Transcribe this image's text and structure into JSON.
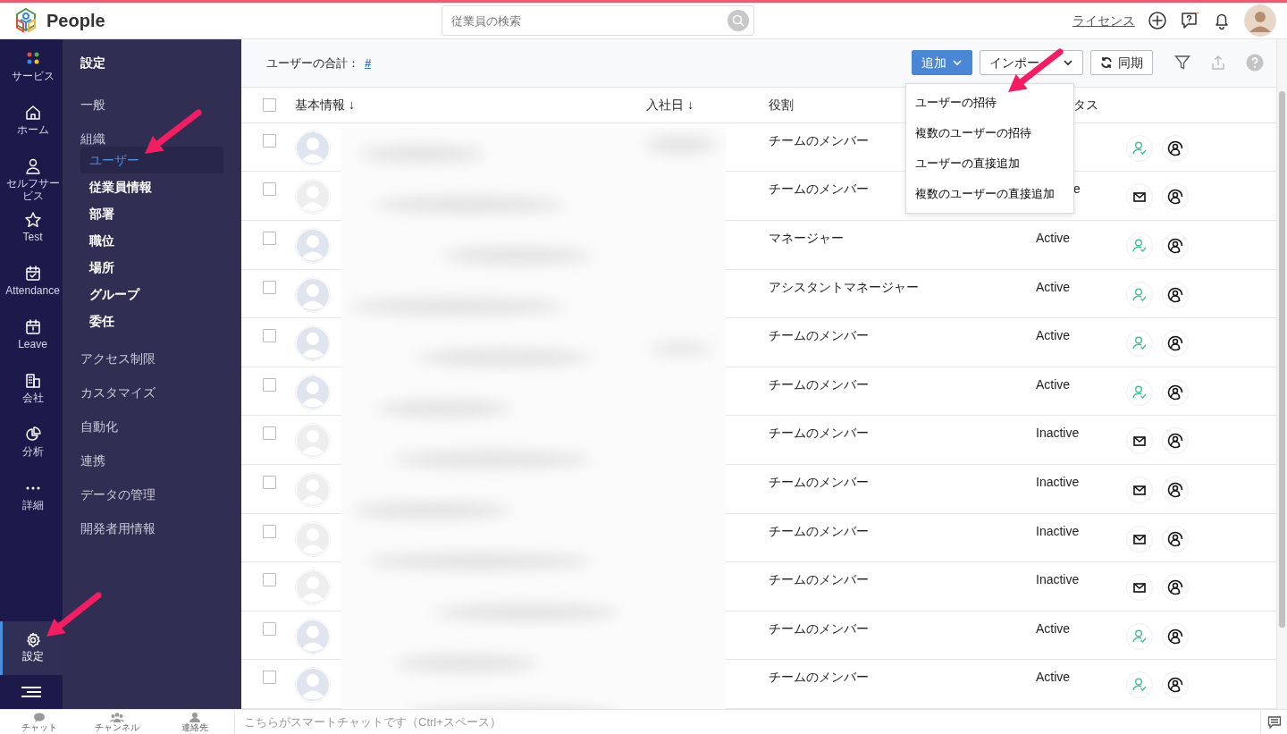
{
  "app": {
    "name": "People"
  },
  "search": {
    "placeholder": "従業員の検索"
  },
  "topbar": {
    "license": "ライセンス"
  },
  "rail": [
    {
      "label": "サービス",
      "selected": false
    },
    {
      "label": "ホーム",
      "selected": false
    },
    {
      "label": "セルフサービス",
      "selected": false
    },
    {
      "label": "Test",
      "selected": false
    },
    {
      "label": "Attendance",
      "selected": false
    },
    {
      "label": "Leave",
      "selected": false
    },
    {
      "label": "会社",
      "selected": false
    },
    {
      "label": "分析",
      "selected": false
    },
    {
      "label": "詳細",
      "selected": false
    }
  ],
  "rail_settings": {
    "label": "設定",
    "selected": true
  },
  "settings_menu": {
    "title": "設定",
    "items": [
      {
        "label": "一般"
      },
      {
        "label": "組織",
        "children": [
          {
            "label": "ユーザー",
            "selected": true
          },
          {
            "label": "従業員情報",
            "selected": false
          },
          {
            "label": "部署",
            "selected": false
          },
          {
            "label": "職位",
            "selected": false
          },
          {
            "label": "場所",
            "selected": false
          },
          {
            "label": "グループ",
            "selected": false
          },
          {
            "label": "委任",
            "selected": false
          }
        ]
      },
      {
        "label": "アクセス制限"
      },
      {
        "label": "カスタマイズ"
      },
      {
        "label": "自動化"
      },
      {
        "label": "連携"
      },
      {
        "label": "データの管理"
      },
      {
        "label": "開発者用情報"
      }
    ]
  },
  "toolbar": {
    "total_label": "ユーザーの合計：",
    "total_value": "#",
    "buttons": [
      {
        "label": "追加",
        "kind": "primary"
      },
      {
        "label": "インポー",
        "kind": "dropdown"
      },
      {
        "label": "同期",
        "kind": "sync"
      }
    ]
  },
  "add_menu": {
    "expanded": true,
    "items": [
      "ユーザーの招待",
      "複数のユーザーの招待",
      "ユーザーの直接追加",
      "複数のユーザーの直接追加"
    ]
  },
  "table": {
    "header_checked": false,
    "columns": [
      "基本情報 ↓",
      "入社日 ↓",
      "役割",
      "タス"
    ],
    "rows": [
      {
        "checked": false,
        "kind": "active",
        "role": "チームのメンバー"
      },
      {
        "checked": false,
        "kind": "inactive",
        "role": "チームのメンバー",
        "status": "e"
      },
      {
        "checked": false,
        "kind": "active",
        "role": "マネージャー",
        "status": "Active"
      },
      {
        "checked": false,
        "kind": "active",
        "role": "アシスタントマネージャー",
        "status": "Active"
      },
      {
        "checked": false,
        "kind": "active",
        "role": "チームのメンバー",
        "status": "Active"
      },
      {
        "checked": false,
        "kind": "active",
        "role": "チームのメンバー",
        "status": "Active"
      },
      {
        "checked": false,
        "kind": "inactive",
        "role": "チームのメンバー",
        "status": "Inactive"
      },
      {
        "checked": false,
        "kind": "inactive",
        "role": "チームのメンバー",
        "status": "Inactive"
      },
      {
        "checked": false,
        "kind": "inactive",
        "role": "チームのメンバー",
        "status": "Inactive"
      },
      {
        "checked": false,
        "kind": "inactive",
        "role": "チームのメンバー",
        "status": "Inactive"
      },
      {
        "checked": false,
        "kind": "active",
        "role": "チームのメンバー",
        "status": "Active"
      },
      {
        "checked": false,
        "kind": "active",
        "role": "チームのメンバー",
        "status": "Active"
      }
    ]
  },
  "bottom_bar": {
    "tabs": [
      "チャット",
      "チャンネル",
      "連絡先"
    ],
    "chat_placeholder": "こちらがスマートチャットです（Ctrl+スペース）"
  },
  "annotation_arrows": [
    {
      "kind": "arrow"
    },
    {
      "kind": "arrow"
    },
    {
      "kind": "arrow"
    }
  ]
}
